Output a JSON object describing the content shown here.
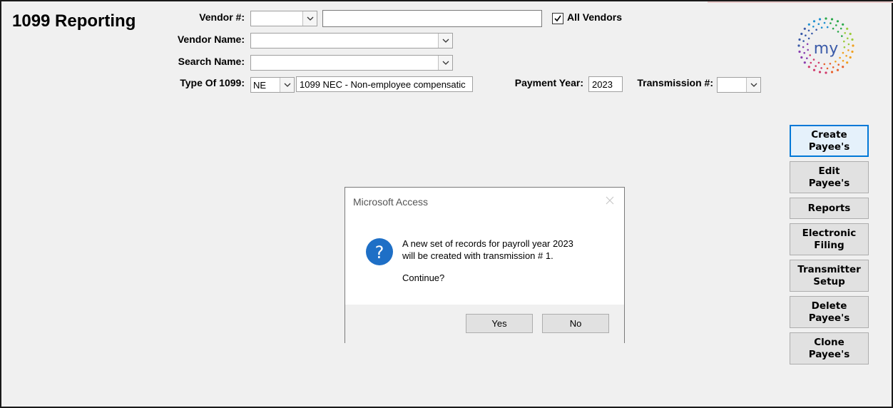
{
  "app": {
    "title": "1099 Reporting"
  },
  "filters": {
    "vendor_num_label": "Vendor #:",
    "vendor_num_value": "",
    "vendor_search_value": "",
    "all_vendors_label": "All Vendors",
    "all_vendors_checked": true,
    "vendor_name_label": "Vendor Name:",
    "vendor_name_value": "",
    "search_name_label": "Search Name:",
    "search_name_value": "",
    "type_label": "Type Of 1099:",
    "type_code": "NE",
    "type_description": "1099 NEC - Non-employee compensatic",
    "payment_year_label": "Payment Year:",
    "payment_year_value": "2023",
    "transmission_label": "Transmission #:",
    "transmission_value": ""
  },
  "logo": {
    "text": "my"
  },
  "side_buttons": [
    {
      "line1": "Create",
      "line2": "Payee's"
    },
    {
      "line1": "Edit",
      "line2": "Payee's"
    },
    {
      "line1": "Reports",
      "line2": ""
    },
    {
      "line1": "Electronic",
      "line2": "Filing"
    },
    {
      "line1": "Transmitter",
      "line2": "Setup"
    },
    {
      "line1": "Delete",
      "line2": "Payee's"
    },
    {
      "line1": "Clone",
      "line2": "Payee's"
    }
  ],
  "dialog": {
    "title": "Microsoft Access",
    "message_line1": "A new set of records for payroll year 2023",
    "message_line2": "will be created with transmission # 1.",
    "message_line3": "Continue?",
    "yes_label": "Yes",
    "no_label": "No"
  },
  "colors": {
    "accent": "#0078d7",
    "icon_blue": "#1e6fc6"
  }
}
